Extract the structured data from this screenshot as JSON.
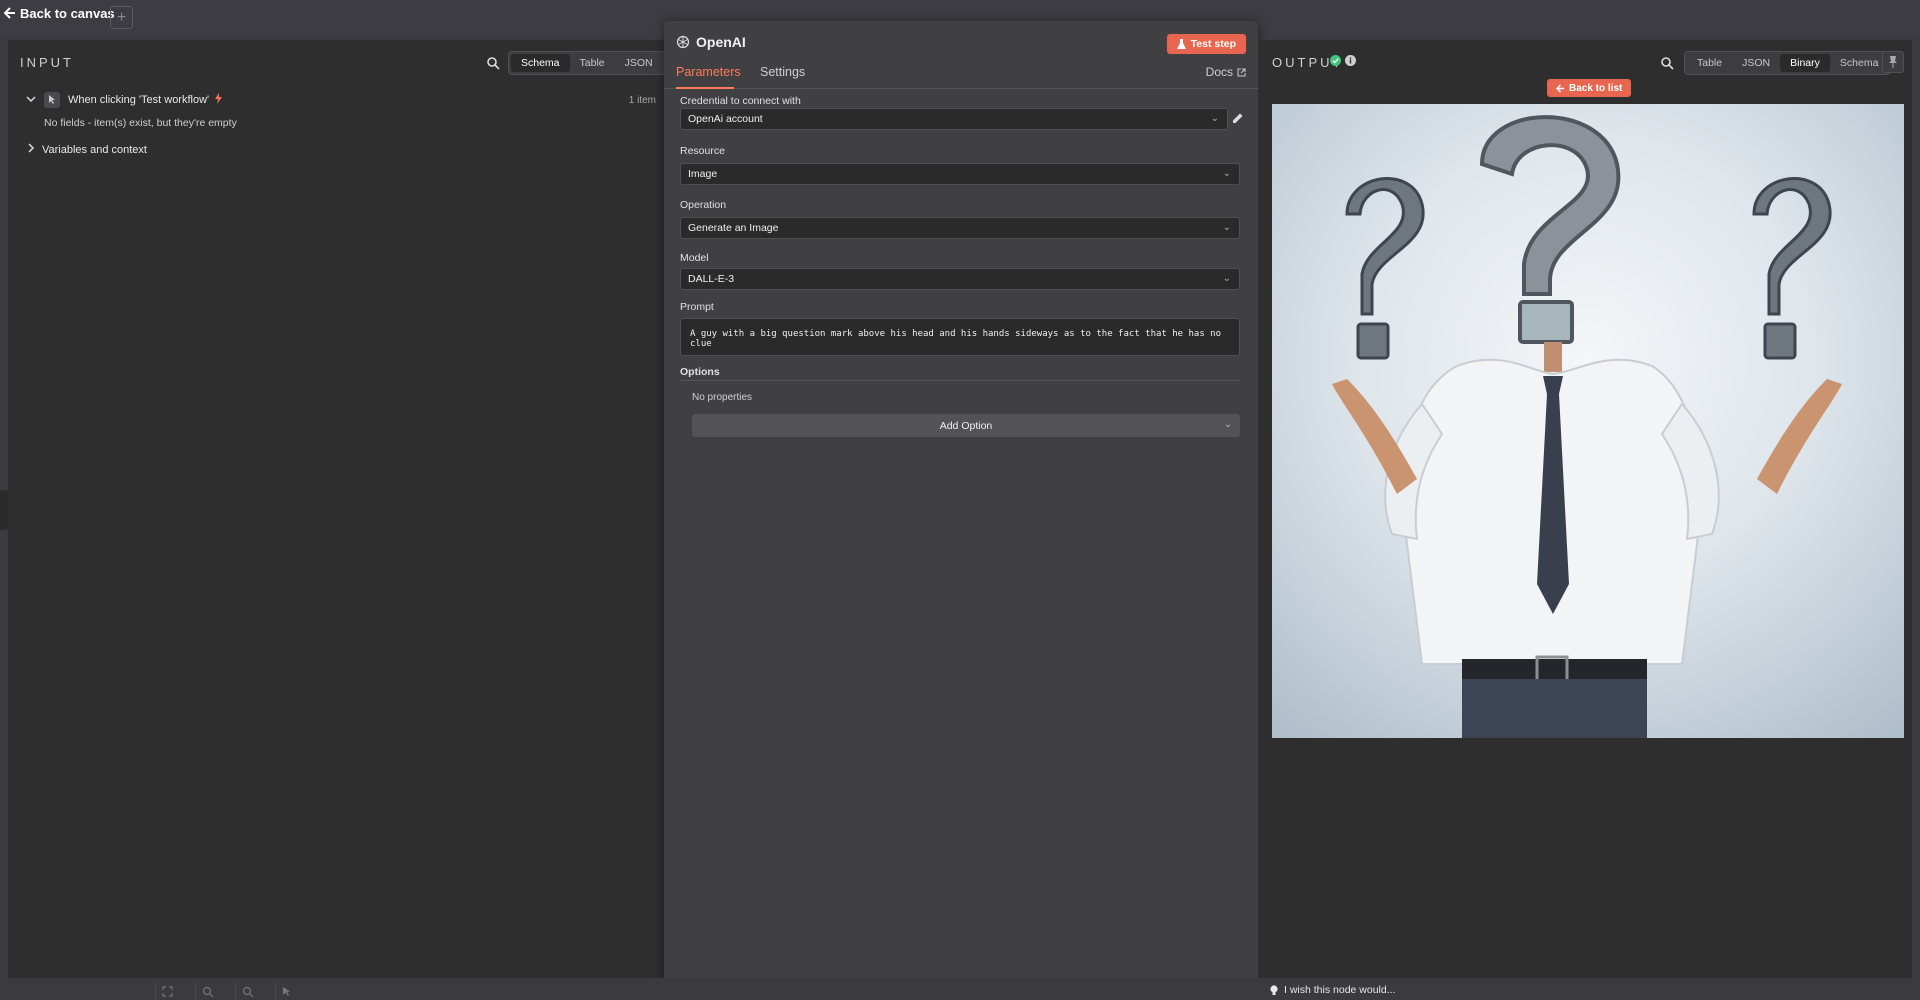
{
  "topbar": {
    "back_label": "Back to canvas",
    "add_label": "+"
  },
  "input": {
    "label": "INPUT",
    "views": [
      "Schema",
      "Table",
      "JSON"
    ],
    "active_view": "Schema",
    "trigger_name": "When clicking 'Test workflow'",
    "item_count": "1 item",
    "empty_msg": "No fields - item(s) exist, but they're empty",
    "vars_label": "Variables and context"
  },
  "node": {
    "title": "OpenAI",
    "test_step_label": "Test step",
    "tabs": [
      "Parameters",
      "Settings"
    ],
    "active_tab": "Parameters",
    "docs_label": "Docs",
    "credential_label": "Credential to connect with",
    "credential_value": "OpenAi account",
    "resource_label": "Resource",
    "resource_value": "Image",
    "operation_label": "Operation",
    "operation_value": "Generate an Image",
    "model_label": "Model",
    "model_value": "DALL-E-3",
    "prompt_label": "Prompt",
    "prompt_value": "A guy with a big question mark above his head and his hands sideways as to the fact that he has no clue",
    "options_label": "Options",
    "no_props": "No properties",
    "add_option_label": "Add Option"
  },
  "output": {
    "label": "OUTPUT",
    "views": [
      "Table",
      "JSON",
      "Binary",
      "Schema"
    ],
    "active_view": "Binary",
    "back_list_label": "Back to list"
  },
  "footer": {
    "feedback": "I wish this node would..."
  },
  "colors": {
    "accent": "#ff6d5a",
    "button": "#e8664f",
    "success": "#3ec77a"
  }
}
